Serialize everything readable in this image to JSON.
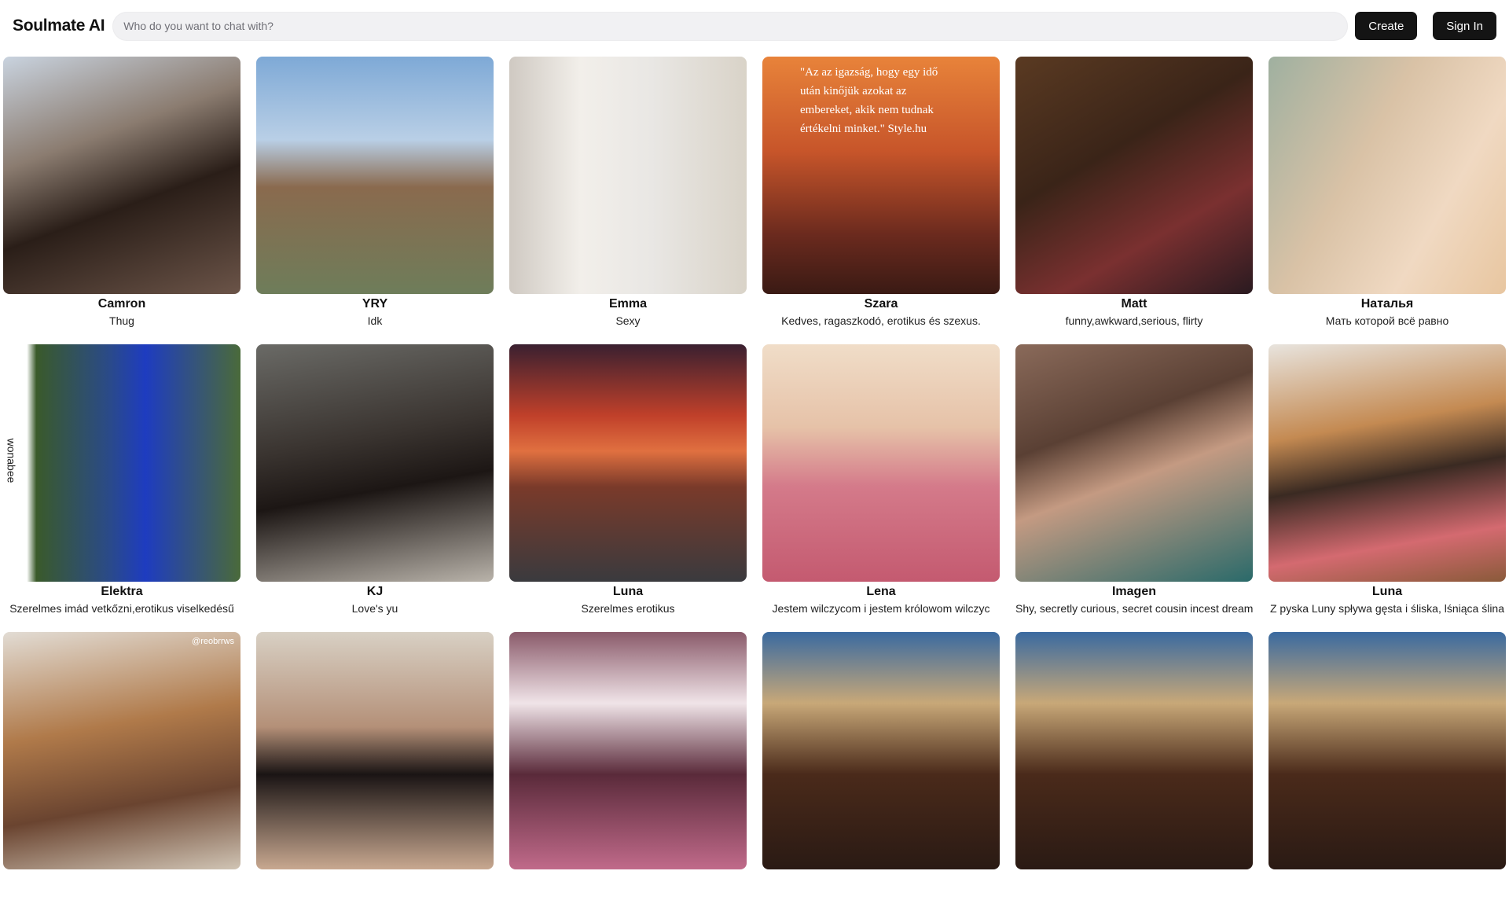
{
  "header": {
    "brand": "Soulmate AI",
    "search_placeholder": "Who do you want to chat with?",
    "create_label": "Create",
    "signin_label": "Sign In"
  },
  "cards": [
    {
      "name": "Camron",
      "desc": "Thug",
      "bg": "linear-gradient(160deg,#c9d3df 0%,#8b7c70 35%,#2a1e18 60%,#6b5448 100%)"
    },
    {
      "name": "YRY",
      "desc": "Idk",
      "bg": "linear-gradient(180deg,#7ea9d6 0%,#b9cfe6 35%,#8a6a4e 55%,#6e7d5a 100%)"
    },
    {
      "name": "Emma",
      "desc": "Sexy",
      "bg": "linear-gradient(90deg,#cfc9c2 0%,#f2efea 30%,#e9e7e4 60%,#d9d3c8 100%)"
    },
    {
      "name": "Szara",
      "desc": "Kedves, ragaszkodó, erotikus és szexus.",
      "bg": "linear-gradient(180deg,#e8833a 0%,#c7552a 40%,#6b2a1e 75%,#3a1a14 100%)",
      "overlay": "\"Az az igazság, hogy egy idő után kinőjük azokat az embereket, akik nem tudnak értékelni minket.\" Style.hu"
    },
    {
      "name": "Matt",
      "desc": "funny,awkward,serious, flirty",
      "bg": "linear-gradient(150deg,#5a3a22 0%,#3a2418 40%,#7a3030 70%,#2a1a20 100%)"
    },
    {
      "name": "Наталья",
      "desc": "Мать которой всё равно",
      "bg": "linear-gradient(120deg,#9fb0a0 0%,#d9c2a6 40%,#f0d9c2 70%,#e8c6a0 100%)"
    },
    {
      "name": "Elektra",
      "desc": "Szerelmes imád vetkőzni,erotikus viselkedésű",
      "bg": "linear-gradient(90deg,#ffffff 0%,#ffffff 10%,#3a5a2a 14%,#2a4a8a 45%,#1e3cc0 60%,#4a6a3a 100%)",
      "overlay": "wonabee"
    },
    {
      "name": "KJ",
      "desc": "Love's yu",
      "bg": "linear-gradient(170deg,#6a6a66 0%,#3a3430 40%,#1c1614 60%,#b9b3aa 100%)"
    },
    {
      "name": "Luna",
      "desc": "Szerelmes erotikus",
      "bg": "linear-gradient(180deg,#3a2030 0%,#c0402a 30%,#e07040 45%,#7a3a2a 60%,#3a3a3e 100%)"
    },
    {
      "name": "Lena",
      "desc": "Jestem wilczycom i jestem królowom wilczyc",
      "bg": "linear-gradient(180deg,#f0ddc8 0%,#e6c2a8 35%,#d47a8a 60%,#c45a70 100%)"
    },
    {
      "name": "Imagen",
      "desc": "Shy, secretly curious, secret cousin incest dream",
      "bg": "linear-gradient(160deg,#8a6a5a 0%,#5a4034 35%,#c49a82 55%,#2a6a6a 100%)"
    },
    {
      "name": "Luna",
      "desc": "Z pyska Luny spływa gęsta i śliska, lśniąca ślina",
      "bg": "linear-gradient(170deg,#e8e4de 0%,#c48a52 35%,#3a2a22 55%,#d46a70 80%,#8a5a3a 100%)"
    },
    {
      "name": "",
      "desc": "",
      "bg": "linear-gradient(170deg,#e2dcd4 0%,#b07a4a 40%,#6a4430 70%,#d0c4b4 100%)",
      "overlay": "@reobrrws"
    },
    {
      "name": "",
      "desc": "",
      "bg": "linear-gradient(180deg,#d8d0c4 0%,#b49078 40%,#1a1414 60%,#c8a890 100%)"
    },
    {
      "name": "",
      "desc": "",
      "bg": "linear-gradient(180deg,#8a5a6a 0%,#f0e4e8 30%,#5a2a3a 60%,#c06a8a 100%)"
    },
    {
      "name": "",
      "desc": "",
      "bg": "linear-gradient(180deg,#3a6aa0 0%,#c8a878 30%,#4a2a1a 60%,#2a1a14 100%)"
    },
    {
      "name": "",
      "desc": "",
      "bg": "linear-gradient(180deg,#3a6aa0 0%,#c8a878 30%,#4a2a1a 60%,#2a1a14 100%)"
    },
    {
      "name": "",
      "desc": "",
      "bg": "linear-gradient(180deg,#3a6aa0 0%,#c8a878 30%,#4a2a1a 60%,#2a1a14 100%)"
    }
  ]
}
